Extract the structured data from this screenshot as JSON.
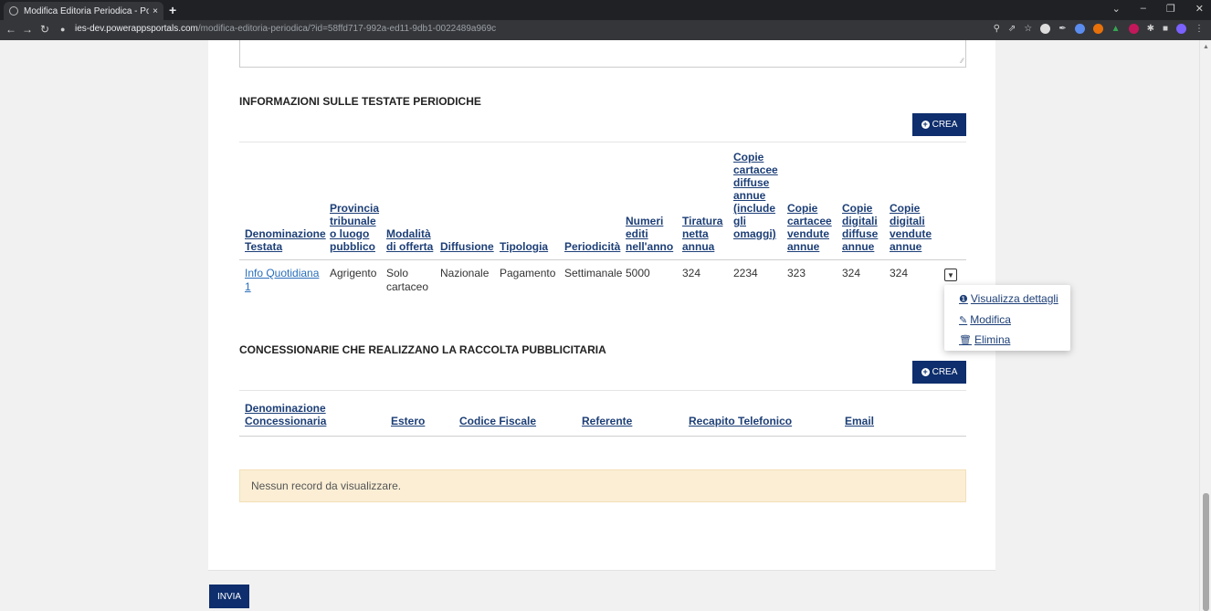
{
  "browser": {
    "tab_title": "Modifica Editoria Periodica - Port",
    "tab_close": "×",
    "new_tab": "+",
    "url_host": "ies-dev.powerappsportals.com",
    "url_path": "/modifica-editoria-periodica/?id=58ffd717-992a-ed11-9db1-0022489a969c"
  },
  "sections": {
    "testate_title": "INFORMAZIONI SULLE TESTATE PERIODICHE",
    "concessionarie_title": "CONCESSIONARIE CHE REALIZZANO LA RACCOLTA PUBBLICITARIA",
    "crea_label": "CREA"
  },
  "testate_table": {
    "headers": [
      "Denominazione\nTestata",
      "Provincia\ntribunale\no luogo\npubblico",
      "Modalità\ndi offerta",
      "Diffusione",
      "Tipologia",
      "Periodicità",
      "Numeri\nediti\nnell'anno",
      "Tiratura\nnetta\nannua",
      "Copie\ncartacee\ndiffuse\nannue\n(include\ngli\nomaggi)",
      "Copie\ncartacee\nvendute\nannue",
      "Copie\ndigitali\ndiffuse\nannue",
      "Copie\ndigitali\nvendute\nannue"
    ],
    "rows": [
      {
        "denominazione": "Info Quotidiana\n1",
        "provincia": "Agrigento",
        "modalita": "Solo\ncartaceo",
        "diffusione": "Nazionale",
        "tipologia": "Pagamento",
        "periodicita": "Settimanale",
        "numeri": "5000",
        "tiratura": "324",
        "copie_cartacee_diffuse": "2234",
        "copie_cartacee_vendute": "323",
        "copie_digitali_diffuse": "324",
        "copie_digitali_vendute": "324"
      }
    ]
  },
  "row_menu": {
    "visualizza": "Visualizza dettagli",
    "modifica": "Modifica",
    "elimina": "Elimina"
  },
  "concessionarie_table": {
    "headers": [
      "Denominazione\nConcessionaria",
      "Estero",
      "Codice Fiscale",
      "Referente",
      "Recapito Telefonico",
      "Email"
    ],
    "empty_message": "Nessun record da visualizzare."
  },
  "submit_label": "INVIA"
}
